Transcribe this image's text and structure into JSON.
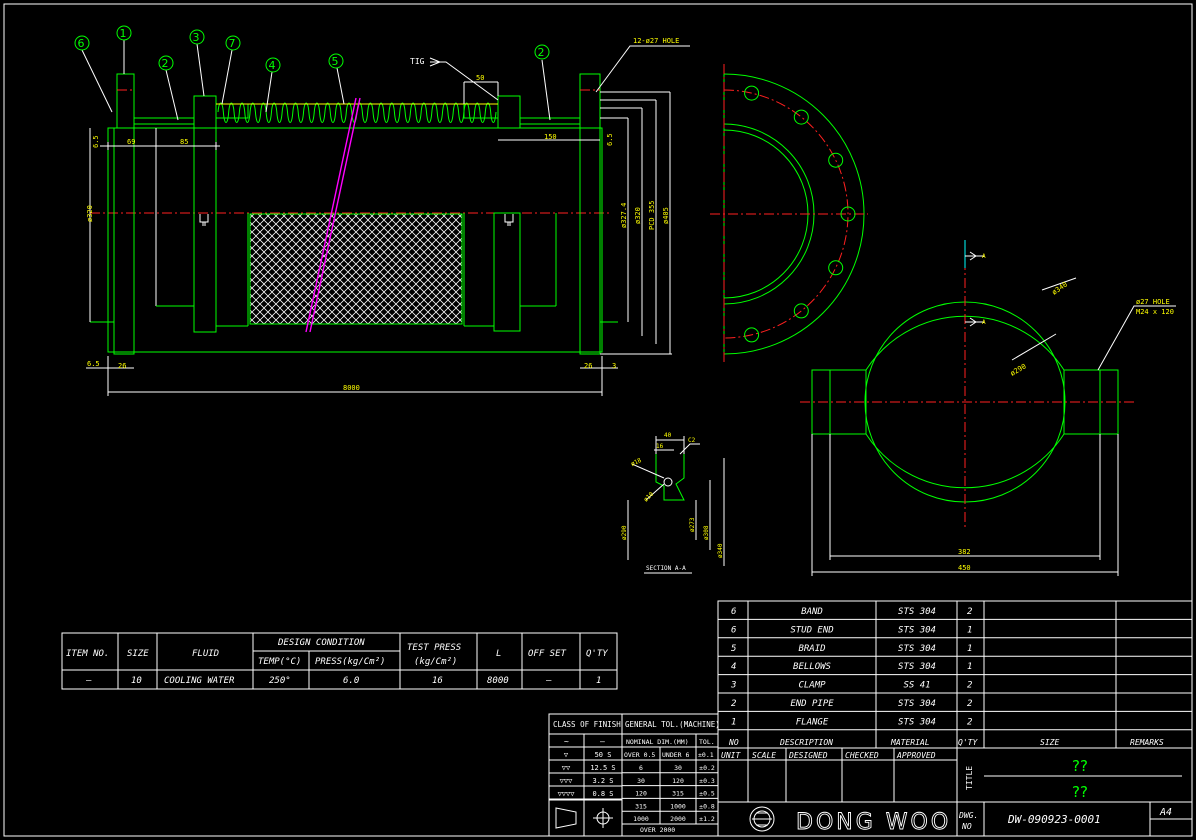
{
  "bubbles": [
    "6",
    "1",
    "2",
    "3",
    "7",
    "4",
    "5",
    "2"
  ],
  "dims": {
    "tig": "TIG",
    "hole_top": "12-ø27 HOLE",
    "d50": "50",
    "d150": "150",
    "d69": "69",
    "d85": "85",
    "d65a": "6.5",
    "d65b": "6.5",
    "d65c": "6.5",
    "d26a": "26",
    "d26b": "26",
    "d3": "3",
    "d8000": "8000",
    "dia320": "ø320",
    "dia3274": "ø327.4",
    "dia320b": "ø320",
    "pcd": "PCD 355",
    "dia405": "ø405",
    "dia340": "ø340",
    "dia290": "ø290",
    "hole_right": "ø27 HOLE",
    "bolt": "M24 x 120",
    "d382": "382",
    "d450": "450",
    "a1": "A",
    "a2": "A",
    "s40": "40",
    "s16": "16",
    "sc2": "C2",
    "s18": "ø18",
    "s10": "ø10",
    "s290": "ø290",
    "s273": "ø273",
    "s308": "ø308",
    "s340": "ø340",
    "section": "SECTION A-A"
  },
  "design": {
    "h_item": "ITEM NO.",
    "h_size": "SIZE",
    "h_fluid": "FLUID",
    "h_cond": "DESIGN CONDITION",
    "h_temp": "TEMP(°C)",
    "h_press": "PRESS(kg/Cm²)",
    "h_test": "TEST PRESS",
    "h_test2": "(kg/Cm²)",
    "h_l": "L",
    "h_offset": "OFF SET",
    "h_qty": "Q'TY",
    "v_item": "–",
    "v_size": "10",
    "v_fluid": "COOLING WATER",
    "v_temp": "250°",
    "v_press": "6.0",
    "v_test": "16",
    "v_l": "8000",
    "v_offset": "–",
    "v_qty": "1"
  },
  "parts": [
    {
      "no": "6",
      "desc": "BAND",
      "mat": "STS 304",
      "qty": "2"
    },
    {
      "no": "6",
      "desc": "STUD END",
      "mat": "STS 304",
      "qty": "1"
    },
    {
      "no": "5",
      "desc": "BRAID",
      "mat": "STS 304",
      "qty": "1"
    },
    {
      "no": "4",
      "desc": "BELLOWS",
      "mat": "STS 304",
      "qty": "1"
    },
    {
      "no": "3",
      "desc": "CLAMP",
      "mat": "SS 41",
      "qty": "2"
    },
    {
      "no": "2",
      "desc": "END PIPE",
      "mat": "STS 304",
      "qty": "2"
    },
    {
      "no": "1",
      "desc": "FLANGE",
      "mat": "STS 304",
      "qty": "2"
    }
  ],
  "parts_head": {
    "no": "NO",
    "desc": "DESCRIPTION",
    "mat": "MATERIAL",
    "qty": "Q'TY",
    "size": "SIZE",
    "remarks": "REMARKS"
  },
  "finish": {
    "title": "CLASS OF FINISH",
    "tilde": "~",
    "dash": "–",
    "rows": [
      {
        "sym": "▽",
        "val": "50 S"
      },
      {
        "sym": "▽▽",
        "val": "12.5 S"
      },
      {
        "sym": "▽▽▽",
        "val": "3.2 S"
      },
      {
        "sym": "▽▽▽▽",
        "val": "0.8 S"
      }
    ]
  },
  "tol": {
    "title": "GENERAL TOL.(MACHINE)",
    "h_nom": "NOMINAL DIM.(MM)",
    "h_tol": "TOL.",
    "h_over": "OVER 0.5",
    "h_under": "UNDER 6",
    "h_t0": "±0.1",
    "rows": [
      {
        "a": "6",
        "b": "30",
        "t": "±0.2"
      },
      {
        "a": "30",
        "b": "120",
        "t": "±0.3"
      },
      {
        "a": "120",
        "b": "315",
        "t": "±0.5"
      },
      {
        "a": "315",
        "b": "1000",
        "t": "±0.8"
      },
      {
        "a": "1000",
        "b": "2000",
        "t": "±1.2"
      }
    ],
    "last": "OVER 2000"
  },
  "title_block": {
    "unit": "UNIT",
    "scale": "SCALE",
    "designed": "DESIGNED",
    "checked": "CHECKED",
    "approved": "APPROVED",
    "title_label": "TITLE",
    "title1": "??",
    "title2": "??",
    "company": "DONG WOO",
    "dwg1": "DWG.",
    "dwg2": "NO",
    "dwg_no": "DW-090923-0001",
    "size": "A4"
  },
  "colors": {
    "bg": "#000000",
    "outline": "#00ff00",
    "dim": "#ffff00",
    "center": "#ff2020",
    "text": "#ffffff",
    "cut": "#ff00ff"
  }
}
